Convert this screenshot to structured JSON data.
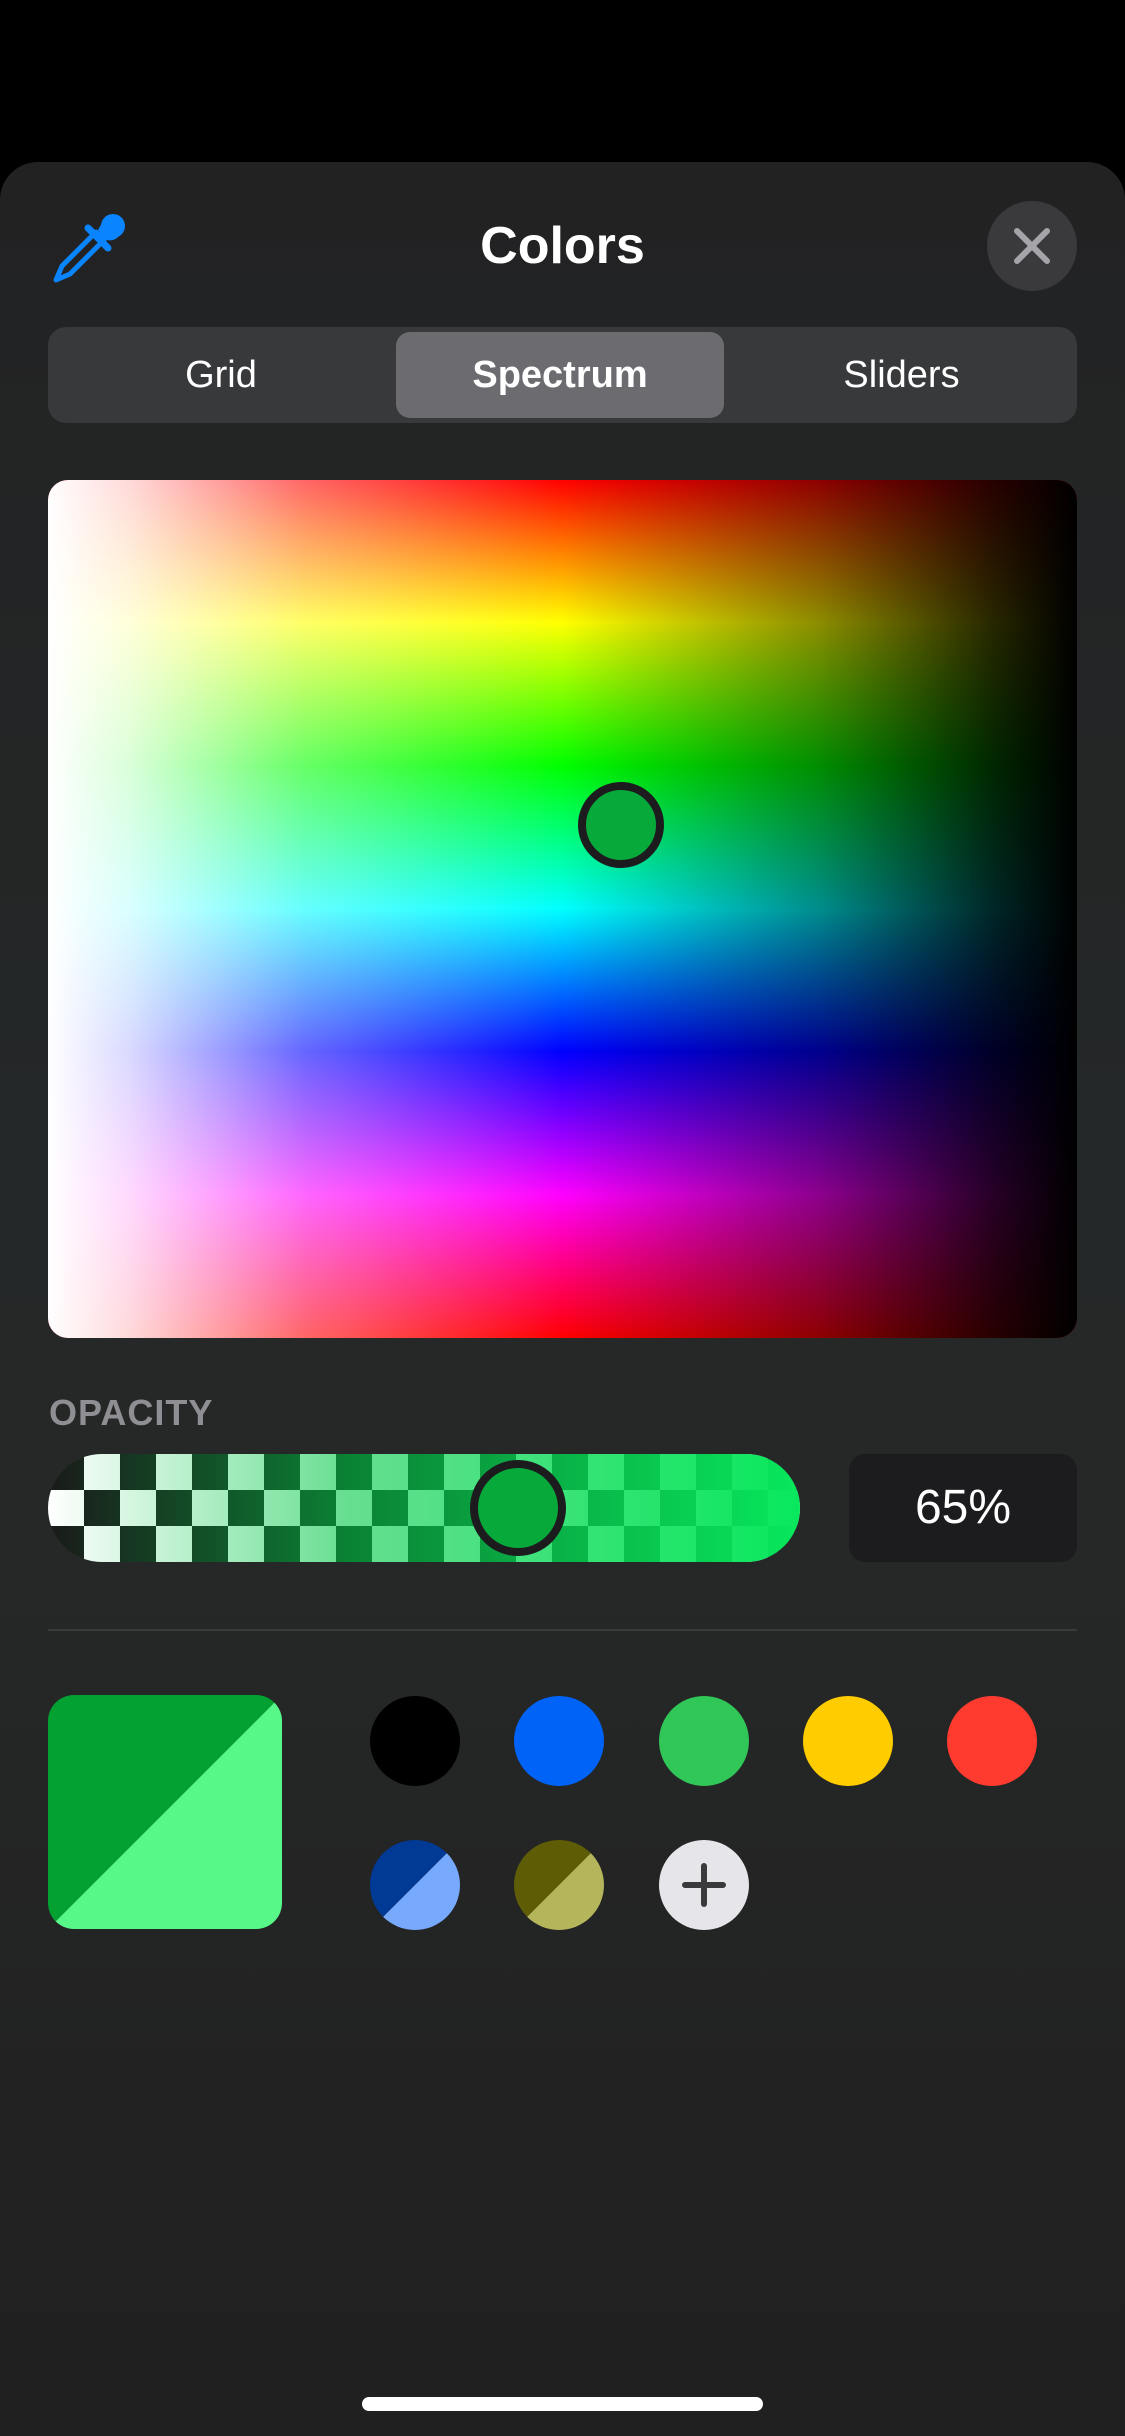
{
  "header": {
    "title": "Colors",
    "eyedropper_icon": "eyedropper-icon",
    "close_icon": "close-icon"
  },
  "tabs": [
    {
      "label": "Grid",
      "selected": false
    },
    {
      "label": "Spectrum",
      "selected": true
    },
    {
      "label": "Sliders",
      "selected": false
    }
  ],
  "opacity": {
    "label": "OPACITY",
    "value": 65,
    "display": "65%"
  },
  "current_color": {
    "primary": "#03a032",
    "with_opacity": "#58f888"
  },
  "swatches": [
    {
      "name": "black",
      "color": "#000000"
    },
    {
      "name": "blue",
      "color": "#0063f7"
    },
    {
      "name": "green",
      "color": "#30c658"
    },
    {
      "name": "yellow",
      "color": "#ffcc00"
    },
    {
      "name": "red",
      "color": "#ff3b30"
    },
    {
      "name": "dark-blue-light-blue",
      "color_a": "#003a94",
      "color_b": "#77a9fd"
    },
    {
      "name": "olive-khaki",
      "color_a": "#5e5c05",
      "color_b": "#b5b55c"
    }
  ],
  "add_swatch_icon": "plus-icon",
  "colors": {
    "accent": "#0a84ff",
    "selected_green": "#07a93a"
  }
}
